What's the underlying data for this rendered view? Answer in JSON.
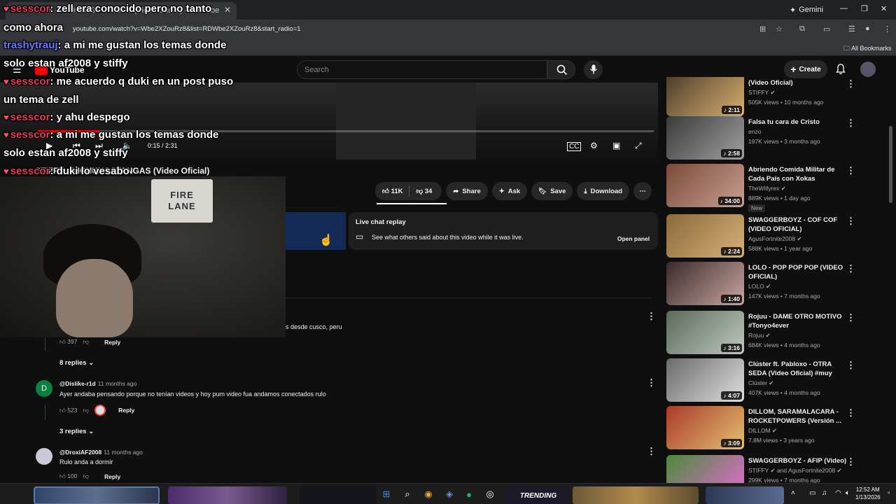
{
  "browser": {
    "tab_title": "STIFFY - NICHUNGSTANGAS (Video Oficial) - YouTube",
    "url": "youtube.com/watch?v=Wbe2XZouRz8&list=RDWbe2XZouRz8&start_radio=1",
    "gemini_label": "Gemini",
    "all_bookmarks": "All Bookmarks"
  },
  "youtube": {
    "logo_text": "YouTube",
    "search_placeholder": "Search",
    "create_label": "Create"
  },
  "player": {
    "time": "0:15 / 2:31",
    "progress_fraction": 0.1
  },
  "video": {
    "title": "STIFFY - NICHUNGSTANGAS (Video Oficial)",
    "like_count": "11K",
    "dislike_count": "34",
    "share_label": "Share",
    "ask_label": "Ask",
    "save_label": "Save",
    "download_label": "Download"
  },
  "live_chat": {
    "title": "Live chat replay",
    "description": "See what others said about this video while it was live.",
    "open_label": "Open panel"
  },
  "comments": [
    {
      "text_fragment": "s desde cusco, peru",
      "likes": "397",
      "reply_label": "Reply",
      "replies_label": "8 replies"
    },
    {
      "avatar_letter": "D",
      "avatar_color": "#0b8043",
      "author": "@Dislike-r1d",
      "ago": "11 months ago",
      "text": "Ayer andaba pensando porque no tenían videos y hoy pum video fua andamos conectados rulo",
      "likes": "523",
      "reply_label": "Reply",
      "replies_label": "3 replies"
    },
    {
      "author": "@DroxiAF2008",
      "ago": "11 months ago",
      "text": "Rulo anda a dormir",
      "likes": "100",
      "reply_label": "Reply"
    }
  ],
  "recommendations": [
    {
      "title": "(Video Oficial)",
      "channel": "STIFFY",
      "meta": "505K views • 10 months ago",
      "duration": "2:11",
      "verified": true
    },
    {
      "title": "Falsa tu cara de Cristo",
      "channel": "enzo",
      "meta": "197K views • 3 months ago",
      "duration": "2:58",
      "verified": false
    },
    {
      "title": "Abriendo Comida Militar de Cada País con Xokas",
      "channel": "TheWillyrex",
      "meta": "889K views • 1 day ago",
      "duration": "34:00",
      "verified": true,
      "badge": "New"
    },
    {
      "title": "SWAGGERBOYZ - COF COF (VIDEO OFICIAL)",
      "channel": "AgusFortnite2008",
      "meta": "588K views • 1 year ago",
      "duration": "2:24",
      "verified": true
    },
    {
      "title": "LOLO - POP POP POP (VIDEO OFICIAL)",
      "channel": "LOLO",
      "meta": "147K views • 7 months ago",
      "duration": "1:40",
      "verified": true
    },
    {
      "title": "Rojuu - DAME OTRO MOTIVO #Tonyo4ever",
      "channel": "Rojuu",
      "meta": "684K views • 4 months ago",
      "duration": "3:16",
      "verified": true
    },
    {
      "title": "Clúster ft. Pabloxo - OTRA SEDA (Video Oficial) #muy #imbecil",
      "channel": "Clúster",
      "meta": "407K views • 4 months ago",
      "duration": "4:07",
      "verified": true
    },
    {
      "title": "DILLOM, SARAMALACARA - ROCKETPOWERS (Versión ...",
      "channel": "DILLOM",
      "meta": "7.8M views • 3 years ago",
      "duration": "3:09",
      "verified": true
    },
    {
      "title": "SWAGGERBOYZ - AFIP (Video)",
      "channel": "STIFFY",
      "channel_extra": "and AgusFortnite2008",
      "meta": "299K views • 7 months ago",
      "duration": "",
      "verified": true
    }
  ],
  "chat_overlay": [
    {
      "user": "sesscor",
      "message": "zell era conocido pero no tanto",
      "kind": "heart"
    },
    {
      "user": "",
      "message": "como ahora",
      "kind": "wrap"
    },
    {
      "user": "trashytrauj",
      "message": "a mi me gustan los temas donde",
      "kind": "plain"
    },
    {
      "user": "",
      "message": "solo estan af2008 y stiffy",
      "kind": "wrap"
    },
    {
      "user": "sesscor",
      "message": "me acuerdo q duki en un post puso",
      "kind": "heart"
    },
    {
      "user": "",
      "message": "un tema de zell",
      "kind": "wrap"
    },
    {
      "user": "sesscor",
      "message": "y ahu despego",
      "kind": "heart"
    },
    {
      "user": "sesscor",
      "message": "a mi me gustan los temas donde",
      "kind": "heart"
    },
    {
      "user": "",
      "message": "solo estan af2008 y stiffy",
      "kind": "wrap"
    },
    {
      "user": "sesscor",
      "message": "duki lo vesabo",
      "kind": "heart"
    }
  ],
  "webcam": {
    "sign_line1": "FIRE",
    "sign_line2": "LANE"
  },
  "taskbar": {
    "time": "12:52 AM",
    "date": "1/13/2026",
    "trending_label": "TRENDING"
  },
  "colors": {
    "background": "#0f0f0f",
    "accent_red": "#ff0000",
    "chip": "#272727",
    "chat_user": "#e83a5c"
  }
}
